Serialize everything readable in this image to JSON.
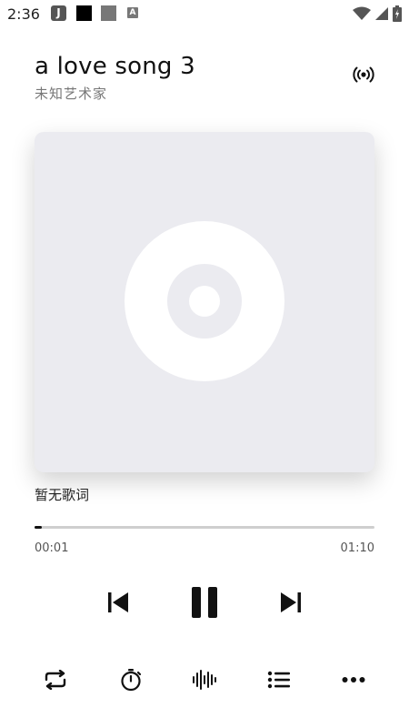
{
  "status_bar": {
    "time": "2:36",
    "app_icons": [
      "music-app-icon",
      "black-square-icon",
      "gray-square-icon",
      "a-badge-icon"
    ],
    "right_icons": [
      "wifi-icon",
      "signal-icon",
      "battery-icon"
    ]
  },
  "song": {
    "title": "a love song 3",
    "artist": "未知艺术家"
  },
  "lyrics": {
    "text": "暂无歌词"
  },
  "progress": {
    "elapsed": "00:01",
    "total": "01:10",
    "fraction": 0.014
  },
  "controls": [
    "previous-icon",
    "pause-icon",
    "next-icon"
  ],
  "toolbar": [
    "repeat-icon",
    "timer-icon",
    "sound-wave-icon",
    "playlist-icon",
    "more-icon"
  ],
  "colors": {
    "cover_bg": "#ebebf0",
    "accent": "#111111",
    "track": "#cfcfcf"
  }
}
